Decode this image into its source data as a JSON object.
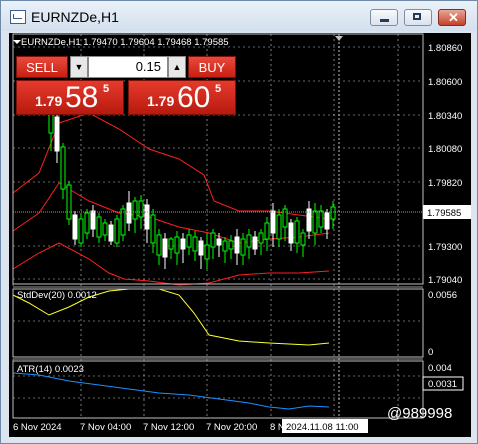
{
  "window": {
    "title": "EURNZDe,H1",
    "minimize_label": "minimize",
    "restore_label": "restore",
    "close_label": "close"
  },
  "chart": {
    "header": "EURNZDe,H1  1.79470 1.79604 1.79468 1.79585",
    "price_ticks": [
      "1.80860",
      "1.80600",
      "1.80340",
      "1.80080",
      "1.79820",
      "1.79300",
      "1.79040"
    ],
    "current_price": "1.79585",
    "std_label": "StdDev(20) 0.0012",
    "std_ticks": [
      "0.0056",
      "0"
    ],
    "atr_label": "ATR(14) 0.0023",
    "atr_ticks": [
      "0.004",
      "0.0031"
    ],
    "time_ticks": [
      "6 Nov 2024",
      "7 Nov 04:00",
      "7 Nov 12:00",
      "7 Nov 20:00",
      "8 No"
    ],
    "crosshair_time": "2024.11.08 11:00",
    "watermark": "@989998",
    "colors": {
      "background": "#000000",
      "candle_bull": "#00ff00",
      "candle_bear": "#ffffff",
      "bands": "#ff2020",
      "stddev": "#ffff33",
      "atr": "#1e90ff",
      "grid": "#cfcfcf"
    }
  },
  "trade": {
    "sell_label": "SELL",
    "buy_label": "BUY",
    "lot": "0.15",
    "lot_dec": "▼",
    "lot_inc": "▲",
    "bid_small": "1.79",
    "bid_big": "58",
    "bid_sup": "5",
    "ask_small": "1.79",
    "ask_big": "60",
    "ask_sup": "5"
  }
}
